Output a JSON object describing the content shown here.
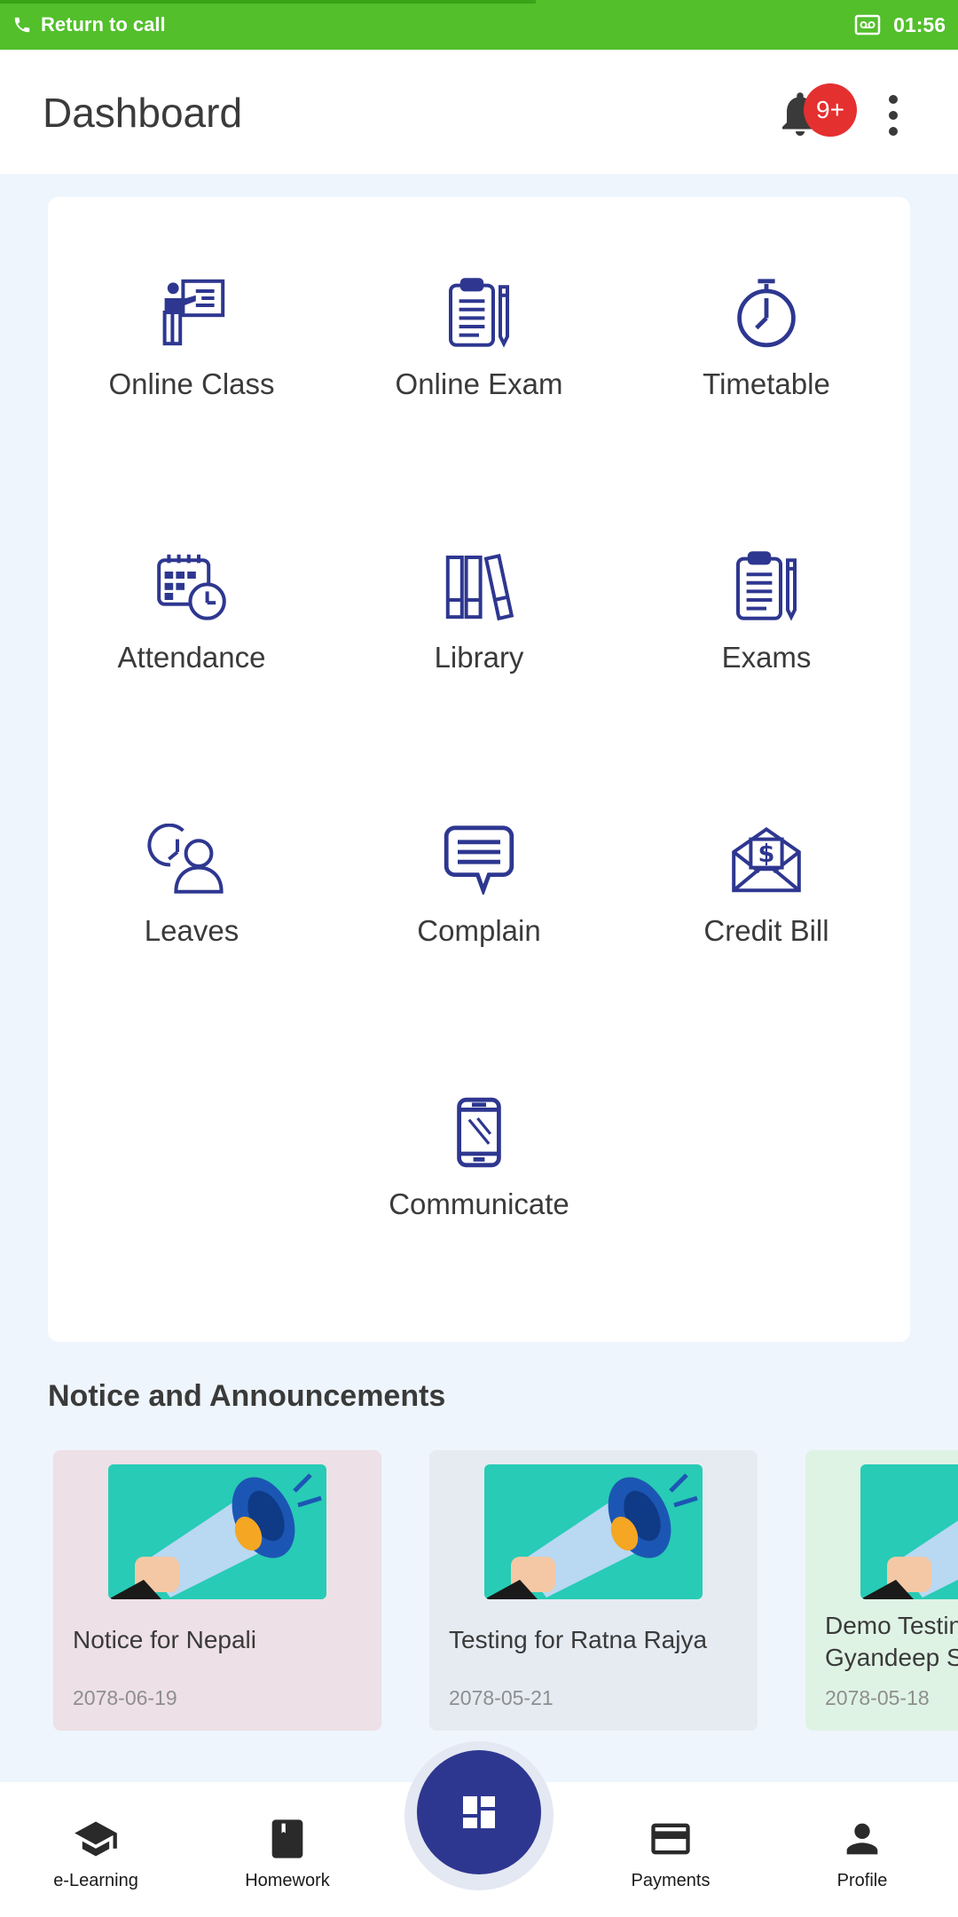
{
  "status_bar": {
    "call_text": "Return to call",
    "time": "01:56"
  },
  "header": {
    "title": "Dashboard",
    "badge": "9+"
  },
  "grid": [
    {
      "label": "Online Class",
      "icon": "presentation-icon"
    },
    {
      "label": "Online Exam",
      "icon": "clipboard-icon"
    },
    {
      "label": "Timetable",
      "icon": "stopwatch-icon"
    },
    {
      "label": "Attendance",
      "icon": "calendar-clock-icon"
    },
    {
      "label": "Library",
      "icon": "books-icon"
    },
    {
      "label": "Exams",
      "icon": "clipboard-pencil-icon"
    },
    {
      "label": "Leaves",
      "icon": "user-clock-icon"
    },
    {
      "label": "Complain",
      "icon": "chat-bubble-icon"
    },
    {
      "label": "Credit Bill",
      "icon": "envelope-dollar-icon"
    },
    {
      "label": "Communicate",
      "icon": "mobile-phone-icon"
    }
  ],
  "notices": {
    "title": "Notice and Announcements",
    "items": [
      {
        "title": "Notice for Nepali",
        "date": "2078-06-19",
        "bg": "#ede0e6"
      },
      {
        "title": "Testing for Ratna Rajya",
        "date": "2078-05-21",
        "bg": "#e6ebf2"
      },
      {
        "title": "Demo Testing for Gyandeep School",
        "title_line1": "Demo Testin",
        "title_line2": "Gyandeep Sc",
        "date": "2078-05-18",
        "bg": "#dff3e5"
      }
    ]
  },
  "bottom_nav": {
    "items": [
      {
        "label": "e-Learning",
        "icon": "graduation-cap-icon"
      },
      {
        "label": "Homework",
        "icon": "book-icon"
      },
      {
        "label": "Payments",
        "icon": "credit-card-icon"
      },
      {
        "label": "Profile",
        "icon": "person-icon"
      }
    ],
    "center_icon": "dashboard-icon"
  },
  "colors": {
    "accent": "#2e3790",
    "call_bar": "#52bf2b",
    "badge": "#e53030",
    "background": "#eef5fc"
  }
}
